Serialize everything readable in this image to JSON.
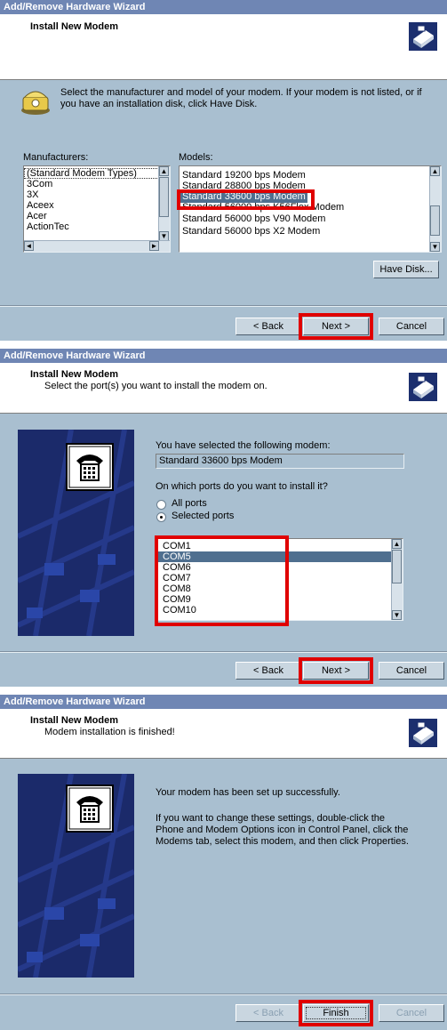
{
  "colors": {
    "title_bar": "#6f86b4",
    "panel": "#a9bfd0",
    "selection": "#4f6f8f",
    "highlight_box": "#e00000",
    "side_image": "#1b2a6a"
  },
  "title": "Add/Remove Hardware Wizard",
  "step1": {
    "header_title": "Install New Modem",
    "instruction": "Select the manufacturer and model of your modem. If your modem is not listed, or if you have an installation disk, click Have Disk.",
    "manufacturers_label": "Manufacturers:",
    "manufacturers": [
      "(Standard Modem Types)",
      "3Com",
      "3X",
      "Aceex",
      "Acer",
      "ActionTec"
    ],
    "models_label": "Models:",
    "models": [
      "Standard 19200 bps Modem",
      "Standard 28800 bps Modem",
      "Standard 33600 bps Modem",
      "Standard 56000 bps K56Flex Modem",
      "Standard 56000 bps V90 Modem",
      "Standard 56000 bps X2 Modem"
    ],
    "have_disk": "Have Disk...",
    "back": "< Back",
    "next": "Next >",
    "cancel": "Cancel"
  },
  "step2": {
    "header_title": "Install New Modem",
    "header_subtitle": "Select the port(s) you want to install the modem on.",
    "selected_label": "You have selected the following modem:",
    "selected_modem": "Standard 33600 bps Modem",
    "ports_question": "On which ports do you want to install it?",
    "all_ports": "All ports",
    "selected_ports": "Selected ports",
    "ports": [
      "COM1",
      "COM5",
      "COM6",
      "COM7",
      "COM8",
      "COM9",
      "COM10"
    ],
    "back": "< Back",
    "next": "Next >",
    "cancel": "Cancel"
  },
  "step3": {
    "header_title": "Install New Modem",
    "header_subtitle": "Modem installation is finished!",
    "success": "Your modem has been set up successfully.",
    "info": "If you want to change these settings, double-click the Phone and Modem Options icon in Control Panel, click the Modems tab, select this modem, and then click Properties.",
    "back": "< Back",
    "finish": "Finish",
    "cancel": "Cancel"
  }
}
